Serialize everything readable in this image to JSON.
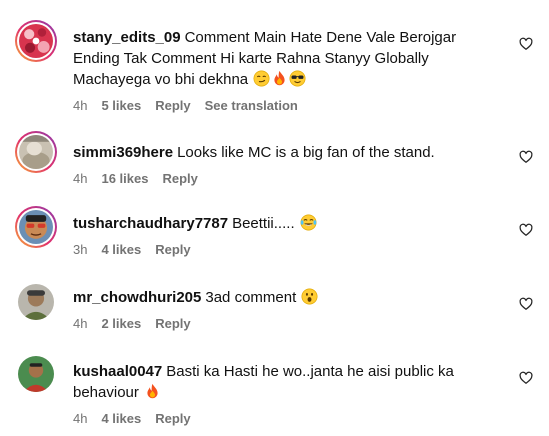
{
  "comments": [
    {
      "username": "stany_edits_09",
      "text": "Comment Main Hate Dene Vale Berojgar Ending Tak Comment Hi karte Rahna Stanyy Globally Machayega vo bhi dekhna",
      "emojis": [
        "smirk-emoji",
        "fire-emoji",
        "sunglasses-emoji"
      ],
      "time": "4h",
      "likes": "5 likes",
      "reply_label": "Reply",
      "translation_label": "See translation"
    },
    {
      "username": "simmi369here",
      "text": "Looks like MC is a big fan of the stand.",
      "emojis": [],
      "time": "4h",
      "likes": "16 likes",
      "reply_label": "Reply"
    },
    {
      "username": "tusharchaudhary7787",
      "text": "Beettii.....",
      "emojis": [
        "tears-of-joy-emoji"
      ],
      "time": "3h",
      "likes": "4 likes",
      "reply_label": "Reply"
    },
    {
      "username": "mr_chowdhuri205",
      "text": "3ad comment",
      "emojis": [
        "astonished-emoji"
      ],
      "time": "4h",
      "likes": "2 likes",
      "reply_label": "Reply"
    },
    {
      "username": "kushaal0047",
      "text": "Basti ka Hasti he wo..janta he aisi public ka behaviour",
      "emojis": [
        "fire-emoji"
      ],
      "time": "4h",
      "likes": "4 likes",
      "reply_label": "Reply"
    }
  ],
  "icons": {
    "like": "heart-outline-icon"
  },
  "colors": {
    "text": "#111111",
    "meta": "#737373",
    "story_ring_start": "#f9b234",
    "story_ring_end": "#833ab4"
  }
}
